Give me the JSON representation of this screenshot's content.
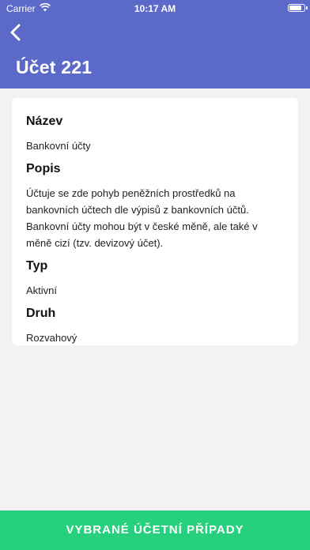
{
  "status_bar": {
    "carrier": "Carrier",
    "time": "10:17 AM"
  },
  "header": {
    "title": "Účet 221",
    "back_icon": "chevron-left-icon"
  },
  "details": [
    {
      "label": "Název",
      "value": "Bankovní účty"
    },
    {
      "label": "Popis",
      "value": "Účtuje se zde pohyb peněžních prostředků na bankovních účtech dle výpisů z bankovních účtů. Bankovní účty mohou být v české měně, ale také v měně cizí (tzv. devizový účet)."
    },
    {
      "label": "Typ",
      "value": "Aktivní"
    },
    {
      "label": "Druh",
      "value": "Rozvahový"
    }
  ],
  "bottom_button": {
    "label": "VYBRANÉ ÚČETNÍ PŘÍPADY"
  },
  "colors": {
    "header_bg": "#5b69c9",
    "button_bg": "#26d07c",
    "page_bg": "#f2f2f2"
  }
}
